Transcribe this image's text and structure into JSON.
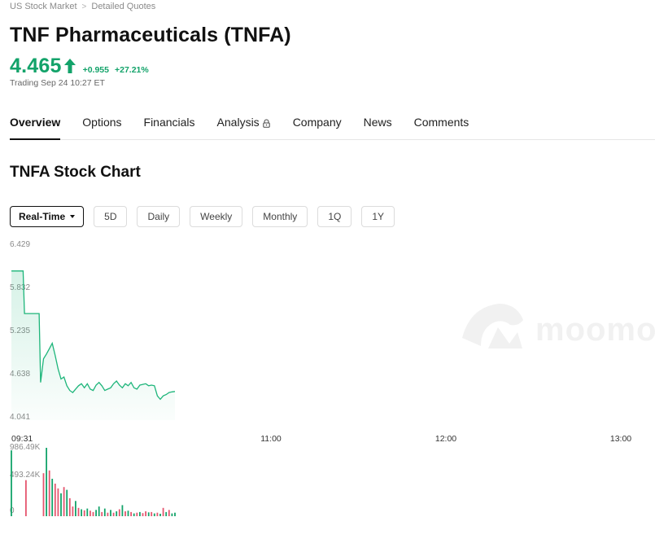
{
  "breadcrumb": {
    "items": [
      "US Stock Market",
      "Detailed Quotes"
    ]
  },
  "stock": {
    "title": "TNF Pharmaceuticals (TNFA)",
    "price": "4.465",
    "change": "+0.955",
    "change_pct": "+27.21%",
    "trading_time": "Trading Sep 24 10:27 ET",
    "up_color": "#13a36a"
  },
  "tabs": [
    {
      "label": "Overview",
      "active": true
    },
    {
      "label": "Options"
    },
    {
      "label": "Financials"
    },
    {
      "label": "Analysis",
      "icon": "lock-icon"
    },
    {
      "label": "Company"
    },
    {
      "label": "News"
    },
    {
      "label": "Comments"
    }
  ],
  "section_title": "TNFA Stock Chart",
  "range_buttons": {
    "active_label": "Real-Time",
    "items": [
      "5D",
      "Daily",
      "Weekly",
      "Monthly",
      "1Q",
      "1Y"
    ]
  },
  "watermark": "moomoo",
  "chart_data": {
    "type": "line",
    "title": "",
    "ylim": [
      4.041,
      6.429
    ],
    "yticks": [
      "6.429",
      "5.832",
      "5.235",
      "4.638",
      "4.041"
    ],
    "xticks": [
      "09:31",
      "11:00",
      "12:00",
      "13:00"
    ],
    "x_range_minutes": [
      571,
      780
    ],
    "series": [
      {
        "x": [
          571,
          572,
          572.5,
          573,
          574,
          575,
          575.5,
          576,
          577,
          578,
          579,
          580,
          580.5,
          581,
          582,
          583,
          584,
          585,
          586,
          587,
          588,
          589,
          590,
          591,
          592,
          593,
          594,
          595,
          596,
          597,
          598,
          599,
          600,
          601,
          602,
          603,
          604,
          605,
          606,
          607,
          608,
          609,
          610,
          611,
          612,
          613,
          614,
          615,
          616,
          617,
          618,
          619,
          620,
          621,
          622,
          623,
          624,
          625,
          626,
          627
        ],
        "y": [
          6.25,
          6.25,
          6.25,
          6.25,
          6.25,
          6.25,
          5.62,
          5.62,
          5.62,
          5.62,
          5.62,
          5.62,
          5.62,
          4.6,
          4.95,
          5.02,
          5.1,
          5.18,
          5.0,
          4.8,
          4.65,
          4.68,
          4.55,
          4.48,
          4.45,
          4.5,
          4.55,
          4.58,
          4.52,
          4.58,
          4.5,
          4.48,
          4.56,
          4.6,
          4.55,
          4.48,
          4.5,
          4.52,
          4.58,
          4.62,
          4.56,
          4.52,
          4.58,
          4.55,
          4.6,
          4.52,
          4.5,
          4.56,
          4.57,
          4.58,
          4.55,
          4.56,
          4.55,
          4.4,
          4.35,
          4.4,
          4.42,
          4.45,
          4.46,
          4.465
        ]
      }
    ],
    "volume": {
      "ylim": [
        0,
        986490
      ],
      "yticks": [
        "986.49K",
        "493.24K",
        "0"
      ],
      "x": [
        571,
        576,
        582,
        583,
        584,
        585,
        586,
        587,
        588,
        589,
        590,
        591,
        592,
        593,
        594,
        595,
        596,
        597,
        598,
        599,
        600,
        601,
        602,
        603,
        604,
        605,
        606,
        607,
        608,
        609,
        610,
        611,
        612,
        613,
        614,
        615,
        616,
        617,
        618,
        619,
        620,
        621,
        622,
        623,
        624,
        625,
        626,
        627
      ],
      "v": [
        950000,
        520000,
        620000,
        1060000,
        660000,
        540000,
        470000,
        400000,
        330000,
        420000,
        380000,
        260000,
        140000,
        220000,
        120000,
        100000,
        85000,
        110000,
        80000,
        60000,
        90000,
        140000,
        60000,
        110000,
        50000,
        90000,
        50000,
        70000,
        100000,
        160000,
        70000,
        80000,
        60000,
        40000,
        50000,
        60000,
        45000,
        70000,
        55000,
        60000,
        40000,
        50000,
        35000,
        120000,
        60000,
        90000,
        40000,
        50000
      ],
      "up": [
        true,
        false,
        false,
        true,
        false,
        true,
        false,
        false,
        true,
        false,
        true,
        false,
        false,
        true,
        false,
        true,
        false,
        true,
        false,
        false,
        true,
        true,
        false,
        true,
        false,
        true,
        false,
        true,
        false,
        true,
        false,
        true,
        false,
        true,
        false,
        true,
        false,
        false,
        true,
        false,
        true,
        false,
        true,
        false,
        true,
        false,
        true,
        true
      ]
    },
    "up_color": "#13a36a",
    "down_color": "#e5566f",
    "line_color": "#1db57a"
  }
}
